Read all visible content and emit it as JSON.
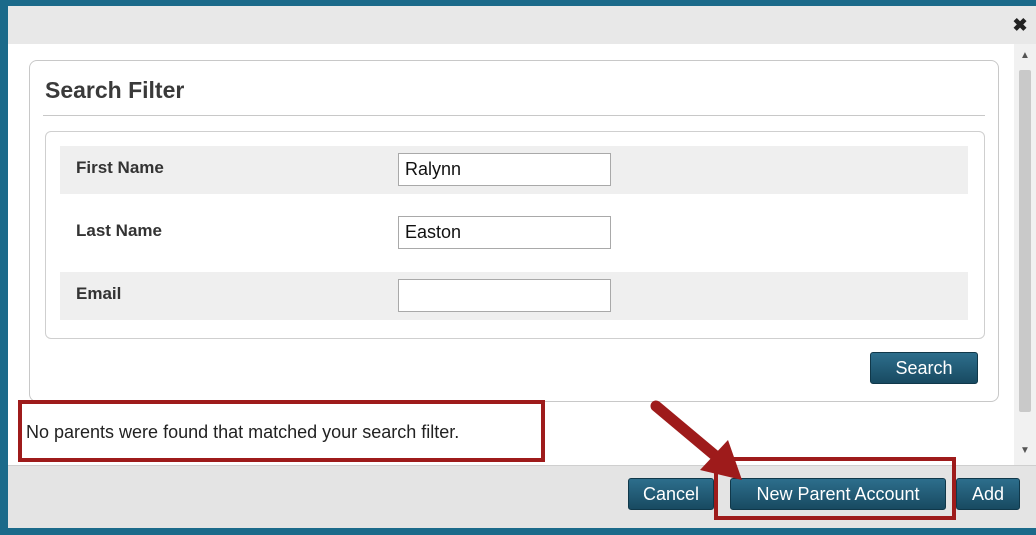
{
  "dialog": {
    "close_label": "✖"
  },
  "filter": {
    "title": "Search Filter",
    "fields": [
      {
        "label": "First Name",
        "value": "Ralynn"
      },
      {
        "label": "Last Name",
        "value": "Easton"
      },
      {
        "label": "Email",
        "value": ""
      }
    ],
    "search_button": "Search"
  },
  "status": {
    "message": "No parents were found that matched your search filter."
  },
  "footer": {
    "cancel_button": "Cancel",
    "new_parent_button": "New Parent Account",
    "add_button": "Add"
  },
  "colors": {
    "highlight": "#9e1b1b",
    "button": "#184a61",
    "frame": "#1b6a8a"
  }
}
